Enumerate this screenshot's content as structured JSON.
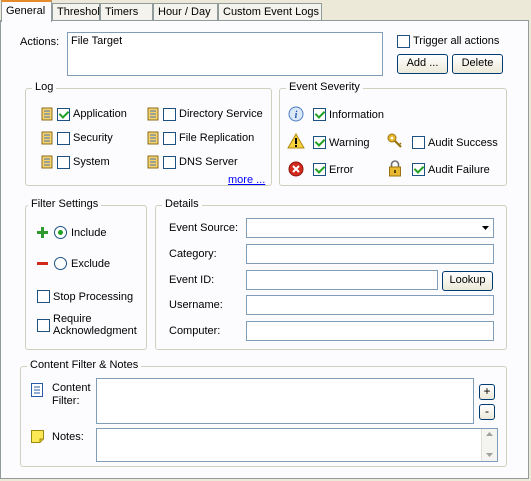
{
  "tabs": [
    {
      "label": "General"
    },
    {
      "label": "Threshold"
    },
    {
      "label": "Timers"
    },
    {
      "label": "Hour / Day"
    },
    {
      "label": "Custom Event Logs"
    }
  ],
  "actions": {
    "label": "Actions:",
    "items": [
      "File Target"
    ],
    "trigger_all_label": "Trigger all actions",
    "trigger_all_checked": false,
    "add_label": "Add ...",
    "delete_label": "Delete"
  },
  "log": {
    "title": "Log",
    "items": [
      {
        "label": "Application",
        "checked": true
      },
      {
        "label": "Directory Service",
        "checked": false
      },
      {
        "label": "Security",
        "checked": false
      },
      {
        "label": "File Replication",
        "checked": false
      },
      {
        "label": "System",
        "checked": false
      },
      {
        "label": "DNS Server",
        "checked": false
      }
    ],
    "more_label": "more ..."
  },
  "severity": {
    "title": "Event Severity",
    "items": [
      {
        "label": "Information",
        "checked": true,
        "icon": "info-icon"
      },
      {
        "label": "Warning",
        "checked": true,
        "icon": "warning-icon"
      },
      {
        "label": "Audit Success",
        "checked": false,
        "icon": "key-icon"
      },
      {
        "label": "Error",
        "checked": true,
        "icon": "error-icon"
      },
      {
        "label": "Audit Failure",
        "checked": true,
        "icon": "lock-icon"
      }
    ]
  },
  "filter_settings": {
    "title": "Filter Settings",
    "include_label": "Include",
    "exclude_label": "Exclude",
    "mode": "include",
    "stop_processing_label": "Stop Processing",
    "stop_processing_checked": false,
    "require_ack_label_line1": "Require",
    "require_ack_label_line2": "Acknowledgment",
    "require_ack_checked": false
  },
  "details": {
    "title": "Details",
    "event_source_label": "Event Source:",
    "event_source_value": "",
    "category_label": "Category:",
    "category_value": "",
    "event_id_label": "Event ID:",
    "event_id_value": "",
    "lookup_label": "Lookup",
    "username_label": "Username:",
    "username_value": "",
    "computer_label": "Computer:",
    "computer_value": ""
  },
  "content": {
    "title": "Content Filter & Notes",
    "content_filter_label_line1": "Content",
    "content_filter_label_line2": "Filter:",
    "content_filter_value": "",
    "plus_label": "+",
    "minus_label": "-",
    "notes_label": "Notes:",
    "notes_value": ""
  },
  "colors": {
    "tab_accent": "#e68b2c",
    "link": "#0000ff",
    "check": "#21a121"
  }
}
